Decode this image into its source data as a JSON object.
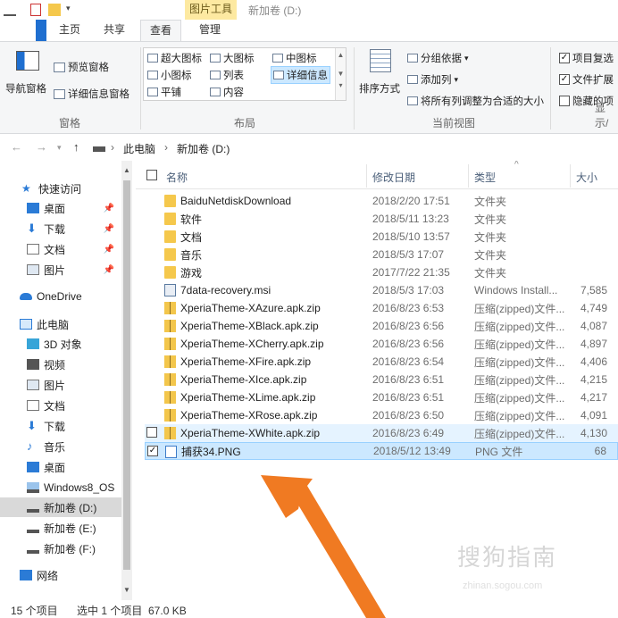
{
  "titlebar": {
    "tools_tab": "图片工具",
    "window_title": "新加卷 (D:)"
  },
  "tabs": [
    {
      "label": "主页"
    },
    {
      "label": "共享"
    },
    {
      "label": "查看"
    },
    {
      "label": "管理"
    }
  ],
  "ribbon": {
    "pane": {
      "nav_pane": "导航窗格",
      "preview_pane": "预览窗格",
      "details_pane": "详细信息窗格",
      "group": "窗格"
    },
    "layout": {
      "items": [
        "超大图标",
        "大图标",
        "中图标",
        "小图标",
        "列表",
        "详细信息",
        "平铺",
        "内容"
      ],
      "group": "布局"
    },
    "current_view": {
      "sort_by": "排序方式",
      "group_by": "分组依据",
      "add_column": "添加列",
      "fit_columns": "将所有列调整为合适的大小",
      "group": "当前视图"
    },
    "show_hide": {
      "item_checkboxes": "项目复选",
      "file_extensions": "文件扩展",
      "hidden_items": "隐藏的项",
      "group": "显示/"
    }
  },
  "address": {
    "crumbs": [
      "此电脑",
      "新加卷 (D:)"
    ]
  },
  "nav": {
    "items": [
      {
        "label": "快速访问",
        "icon": "star-icon"
      },
      {
        "label": "桌面",
        "icon": "desktop-icon"
      },
      {
        "label": "下载",
        "icon": "download-icon"
      },
      {
        "label": "文档",
        "icon": "document-icon"
      },
      {
        "label": "图片",
        "icon": "picture-icon"
      },
      {
        "label": "OneDrive",
        "icon": "cloud-icon"
      },
      {
        "label": "此电脑",
        "icon": "computer-icon"
      },
      {
        "label": "3D 对象",
        "icon": "cube-icon"
      },
      {
        "label": "视频",
        "icon": "video-icon"
      },
      {
        "label": "图片",
        "icon": "picture-icon"
      },
      {
        "label": "文档",
        "icon": "document-icon"
      },
      {
        "label": "下载",
        "icon": "download-icon"
      },
      {
        "label": "音乐",
        "icon": "music-icon"
      },
      {
        "label": "桌面",
        "icon": "desktop-icon"
      },
      {
        "label": "Windows8_OS",
        "icon": "drive-icon"
      },
      {
        "label": "新加卷 (D:)",
        "icon": "drive-icon"
      },
      {
        "label": "新加卷 (E:)",
        "icon": "drive-icon"
      },
      {
        "label": "新加卷 (F:)",
        "icon": "drive-icon"
      },
      {
        "label": "网络",
        "icon": "network-icon"
      }
    ]
  },
  "list": {
    "columns": {
      "name": "名称",
      "date": "修改日期",
      "type": "类型",
      "size": "大小"
    },
    "rows": [
      {
        "name": "BaiduNetdiskDownload",
        "date": "2018/2/20 17:51",
        "type": "文件夹",
        "size": "",
        "icon": "folder-icon"
      },
      {
        "name": "软件",
        "date": "2018/5/11 13:23",
        "type": "文件夹",
        "size": "",
        "icon": "folder-icon"
      },
      {
        "name": "文档",
        "date": "2018/5/10 13:57",
        "type": "文件夹",
        "size": "",
        "icon": "folder-icon"
      },
      {
        "name": "音乐",
        "date": "2018/5/3 17:07",
        "type": "文件夹",
        "size": "",
        "icon": "folder-icon"
      },
      {
        "name": "游戏",
        "date": "2017/7/22 21:35",
        "type": "文件夹",
        "size": "",
        "icon": "folder-icon"
      },
      {
        "name": "7data-recovery.msi",
        "date": "2018/5/3 17:03",
        "type": "Windows Install...",
        "size": "7,585",
        "icon": "installer-icon"
      },
      {
        "name": "XperiaTheme-XAzure.apk.zip",
        "date": "2016/8/23 6:53",
        "type": "压缩(zipped)文件...",
        "size": "4,749",
        "icon": "zip-icon"
      },
      {
        "name": "XperiaTheme-XBlack.apk.zip",
        "date": "2016/8/23 6:56",
        "type": "压缩(zipped)文件...",
        "size": "4,087",
        "icon": "zip-icon"
      },
      {
        "name": "XperiaTheme-XCherry.apk.zip",
        "date": "2016/8/23 6:56",
        "type": "压缩(zipped)文件...",
        "size": "4,897",
        "icon": "zip-icon"
      },
      {
        "name": "XperiaTheme-XFire.apk.zip",
        "date": "2016/8/23 6:54",
        "type": "压缩(zipped)文件...",
        "size": "4,406",
        "icon": "zip-icon"
      },
      {
        "name": "XperiaTheme-XIce.apk.zip",
        "date": "2016/8/23 6:51",
        "type": "压缩(zipped)文件...",
        "size": "4,215",
        "icon": "zip-icon"
      },
      {
        "name": "XperiaTheme-XLime.apk.zip",
        "date": "2016/8/23 6:51",
        "type": "压缩(zipped)文件...",
        "size": "4,217",
        "icon": "zip-icon"
      },
      {
        "name": "XperiaTheme-XRose.apk.zip",
        "date": "2016/8/23 6:50",
        "type": "压缩(zipped)文件...",
        "size": "4,091",
        "icon": "zip-icon"
      },
      {
        "name": "XperiaTheme-XWhite.apk.zip",
        "date": "2016/8/23 6:49",
        "type": "压缩(zipped)文件...",
        "size": "4,130",
        "icon": "zip-icon"
      },
      {
        "name": "捕获34.PNG",
        "date": "2018/5/12 13:49",
        "type": "PNG 文件",
        "size": "68",
        "icon": "png-icon"
      }
    ]
  },
  "status": {
    "item_count": "15 个项目",
    "selection": "选中 1 个项目  67.0 KB"
  },
  "watermark": {
    "text": "搜狗指南",
    "sub": "zhinan.sogou.com"
  },
  "colors": {
    "accent": "#1f6fd0",
    "arrow": "#f07a22",
    "selection": "#cce8ff",
    "tools_tab": "#fde9a1"
  }
}
